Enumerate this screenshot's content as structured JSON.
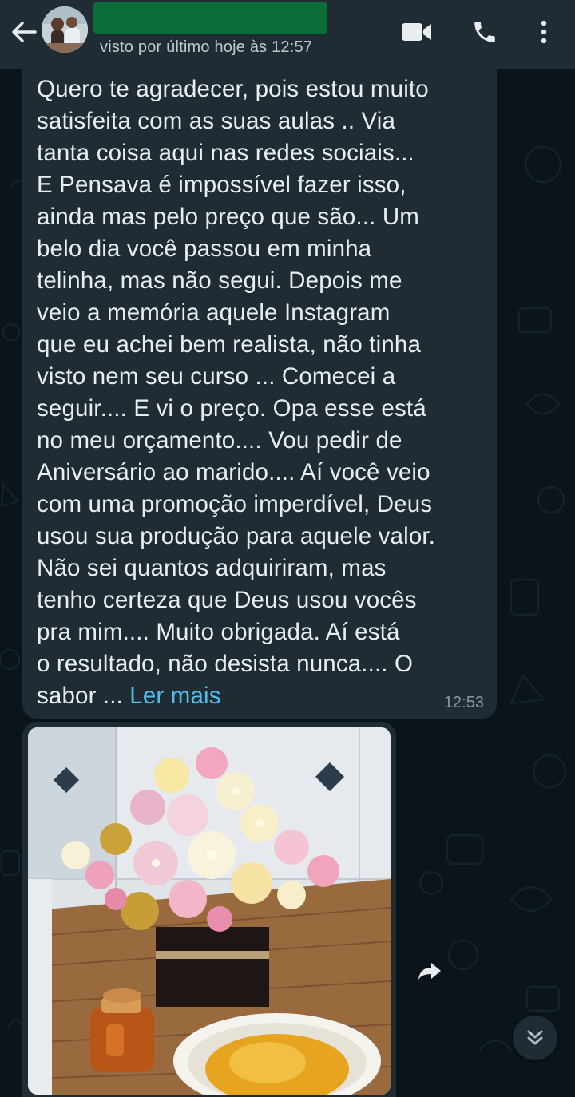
{
  "header": {
    "last_seen": "visto por último hoje às 12:57",
    "name_redaction_color": "#0b6e3a",
    "icons": [
      "back-arrow-icon",
      "video-call-icon",
      "phone-icon",
      "more-vertical-icon"
    ]
  },
  "message": {
    "text": "Quero te agradecer, pois estou muito\nsatisfeita com as suas aulas .. Via\ntanta coisa aqui nas redes sociais...\nE Pensava é impossível fazer isso,\nainda mas pelo preço que são... Um\nbelo dia você passou em minha\ntelinha, mas não segui. Depois me\nveio a memória aquele Instagram\nque eu achei bem realista, não tinha\nvisto nem seu curso ... Comecei a\nseguir.... E vi o preço. Opa esse está\nno meu orçamento.... Vou pedir de\nAniversário ao marido.... Aí você veio\ncom uma promoção imperdível, Deus\nusou sua produção para aquele valor.\nNão sei quantos adquiriram, mas\ntenho certeza que Deus usou vocês\npra mim.... Muito obrigada. Aí está\no resultado, não desista nunca.... O\nsabor ... ",
    "read_more": "Ler mais",
    "time": "12:53"
  },
  "colors": {
    "background": "#0b141a",
    "bubble": "#1f2c34",
    "link": "#53bdeb",
    "meta": "#8696a0"
  }
}
